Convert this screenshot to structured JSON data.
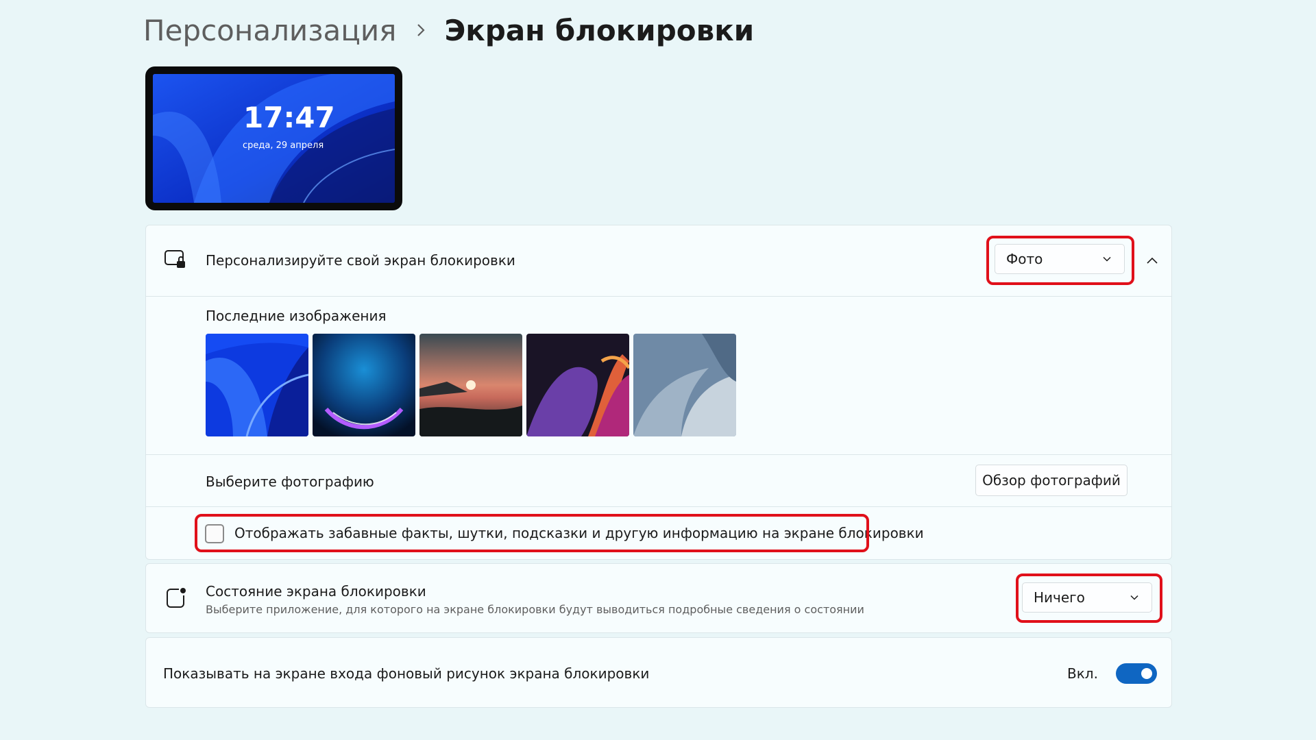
{
  "breadcrumb": {
    "parent": "Персонализация",
    "current": "Экран блокировки"
  },
  "preview": {
    "time": "17:47",
    "date": "среда, 29 апреля"
  },
  "personalize": {
    "label": "Персонализируйте свой экран блокировки",
    "icon": "lockscreen-icon",
    "dropdown_value": "Фото",
    "expanded": true,
    "recent_label": "Последние изображения",
    "recent_images": [
      {
        "name": "blue-bloom-wallpaper"
      },
      {
        "name": "glow-orb-wallpaper"
      },
      {
        "name": "sunset-lake-wallpaper"
      },
      {
        "name": "ribbon-wallpaper"
      },
      {
        "name": "gray-bloom-wallpaper"
      }
    ],
    "choose_label": "Выберите фотографию",
    "browse_button": "Обзор фотографий",
    "facts_checkbox_label": "Отображать забавные факты, шутки, подсказки и другую информацию на экране блокировки",
    "facts_checked": false
  },
  "status": {
    "icon": "status-app-icon",
    "title": "Состояние экрана блокировки",
    "description": "Выберите приложение, для которого на экране блокировки будут выводиться подробные сведения о состоянии",
    "dropdown_value": "Ничего"
  },
  "signin_background": {
    "label": "Показывать на экране входа фоновый рисунок экрана блокировки",
    "state_label": "Вкл.",
    "on": true
  },
  "colors": {
    "accent": "#0f66c2",
    "highlight": "#e0101a",
    "background": "#e9f6f8"
  }
}
